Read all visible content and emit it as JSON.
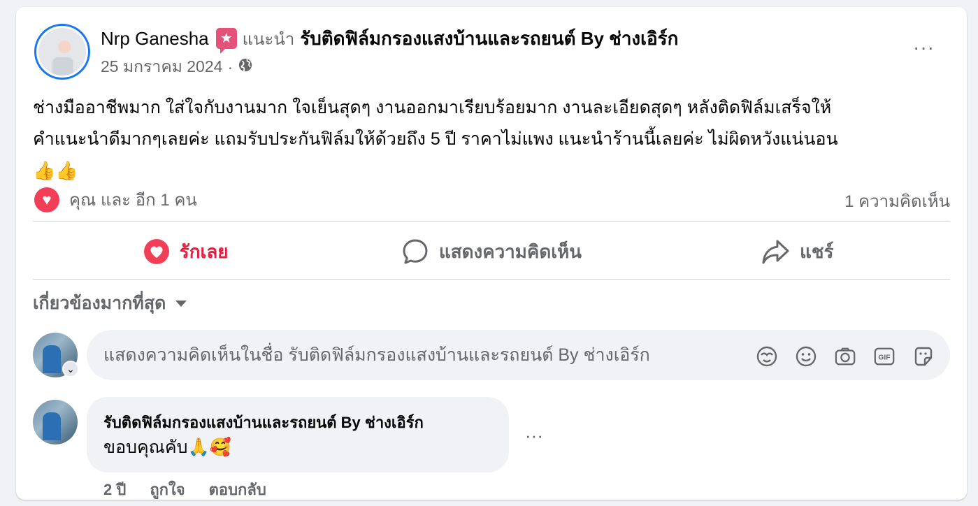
{
  "post": {
    "author": "Nrp Ganesha",
    "recommends_label": "แนะนำ",
    "page_name": "รับติดฟิล์มกรองแสงบ้านและรถยนต์ By ช่างเอิร์ก",
    "date": "25 มกราคม 2024",
    "meta_separator": "·",
    "audience_icon": "globe-icon",
    "more_icon": "···",
    "text_line1": "ช่างมืออาชีพมาก ใส่ใจกับงานมาก ใจเย็นสุดๆ งานออกมาเรียบร้อยมาก งานละเอียดสุดๆ หลังติดฟิล์มเสร็จให้",
    "text_line2": "คำแนะนำดีมากๆเลยค่ะ แถมรับประกันฟิล์มให้ด้วยถึง 5 ปี ราคาไม่แพง แนะนำร้านนี้เลยค่ะ ไม่ผิดหวังแน่นอน",
    "emojis": "👍👍",
    "badge_icon": "star-badge-icon"
  },
  "reactions": {
    "summary": "คุณ และ อีก 1 คน",
    "comment_count": "1 ความคิดเห็น",
    "reaction_icon": "love-icon"
  },
  "actions": {
    "love": "รักเลย",
    "comment": "แสดงความคิดเห็น",
    "share": "แชร์"
  },
  "comments": {
    "sort_label": "เกี่ยวข้องมากที่สุด",
    "input_placeholder": "แสดงความคิดเห็นในชื่อ รับติดฟิล์มกรองแสงบ้านและรถยนต์ By ช่างเอิร์ก",
    "input_icons": [
      "avatar-sticker-icon",
      "emoji-icon",
      "camera-icon",
      "gif-icon",
      "sticker-icon"
    ],
    "reply": {
      "author": "รับติดฟิล์มกรองแสงบ้านและรถยนต์ By ช่างเอิร์ก",
      "text": "ขอบคุณคับ🙏🥰",
      "time": "2 ปี",
      "like": "ถูกใจ",
      "reply": "ตอบกลับ",
      "more_icon": "···"
    }
  },
  "colors": {
    "accent": "#1877f2",
    "love": "#e41e3f",
    "secondary_text": "#65676b",
    "badge": "#e4527a"
  }
}
